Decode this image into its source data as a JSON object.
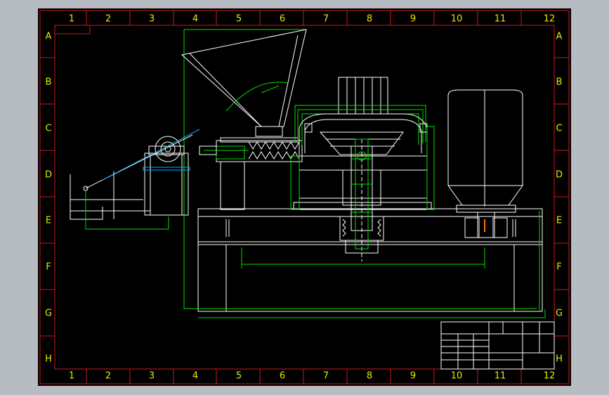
{
  "sheet": {
    "columns": [
      "1",
      "2",
      "3",
      "4",
      "5",
      "6",
      "7",
      "8",
      "9",
      "10",
      "11",
      "12"
    ],
    "rows": [
      "A",
      "B",
      "C",
      "D",
      "E",
      "F",
      "G",
      "H"
    ]
  },
  "colors": {
    "background": "#000000",
    "frame": "#cc1a1a",
    "outline": "#ffffff",
    "construction": "#00e000",
    "dimension": "#00b4ff",
    "zone_text": "#e8e800",
    "accent": "#ff7700",
    "window_surround": "#b7bcc3"
  }
}
